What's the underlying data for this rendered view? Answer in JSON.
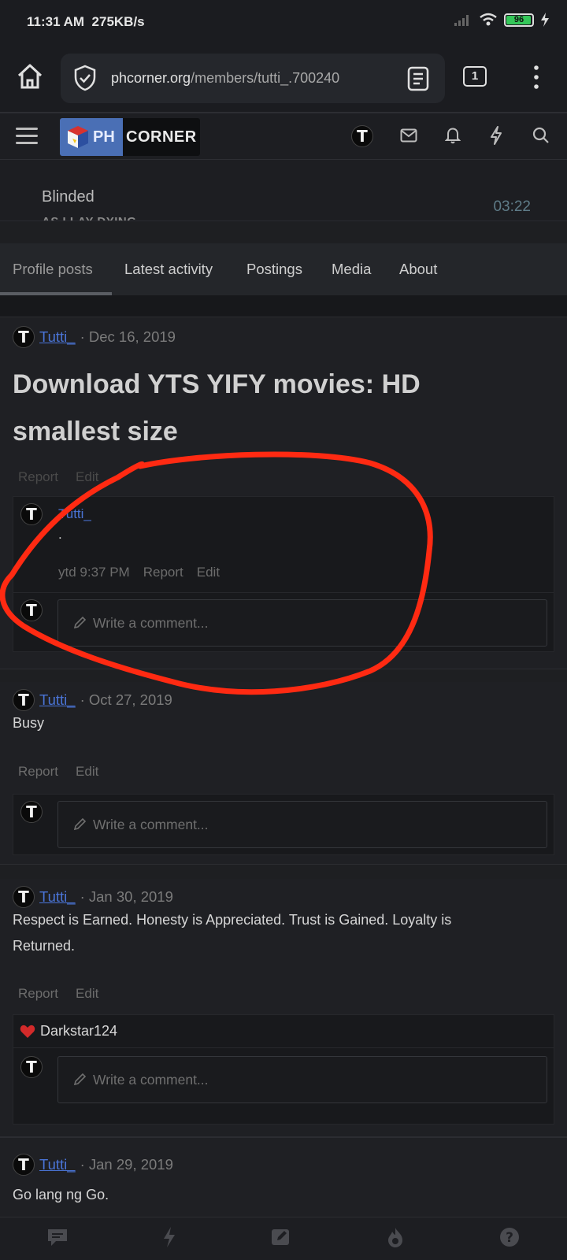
{
  "status_bar": {
    "time": "11:31 AM",
    "speed": "275KB/s",
    "battery": "96"
  },
  "browser": {
    "url_host": "phcorner.org",
    "url_path": "/members/tutti_.700240",
    "tab_count": "1"
  },
  "site": {
    "logo_left": "PH",
    "logo_right": "CORNER",
    "user_initial": "T"
  },
  "media": {
    "title": "Blinded",
    "subtitle": "AS I LAY DYING",
    "time": "03:22"
  },
  "tabs": [
    "Profile posts",
    "Latest activity",
    "Postings",
    "Media",
    "About"
  ],
  "posts": [
    {
      "author": "Tutti_",
      "date": "· Dec 16, 2019",
      "title_line1": "Download YTS YIFY movies: HD",
      "title_line2": "smallest size",
      "actions": [
        "Report",
        "Edit"
      ],
      "comment": {
        "author": "Tutti_",
        "text": ".",
        "time": "ytd 9:37 PM",
        "report": "Report",
        "edit": "Edit"
      },
      "placeholder": "Write a comment..."
    },
    {
      "author": "Tutti_",
      "date": "· Oct 27, 2019",
      "body": "Busy",
      "actions": [
        "Report",
        "Edit"
      ],
      "placeholder": "Write a comment..."
    },
    {
      "author": "Tutti_",
      "date": "· Jan 30, 2019",
      "body_line1": "Respect is Earned. Honesty is Appreciated. Trust is Gained. Loyalty is",
      "body_line2": "Returned.",
      "actions": [
        "Report",
        "Edit"
      ],
      "liker": "Darkstar124",
      "placeholder": "Write a comment..."
    },
    {
      "author": "Tutti_",
      "date": "· Jan 29, 2019",
      "body": "Go lang ng Go."
    }
  ],
  "colors": {
    "link": "#4a74d6",
    "annotation": "#ff2a12",
    "background": "#1e1f22"
  },
  "bottom_nav_icons": [
    "chat-icon",
    "lightning-icon",
    "edit-icon",
    "flame-icon",
    "help-icon"
  ]
}
